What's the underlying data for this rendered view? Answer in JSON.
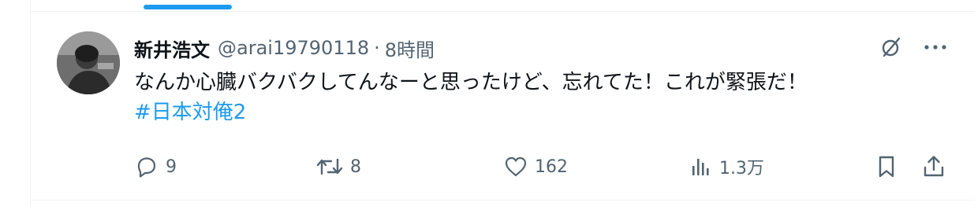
{
  "post": {
    "display_name": "新井浩文",
    "handle": "@arai19790118",
    "separator": "·",
    "time": "8時間",
    "text": "なんか心臓バクバクしてんなーと思ったけど、忘れてた！これが緊張だ！",
    "hashtag": "#日本対俺2"
  },
  "actions": {
    "reply_count": "9",
    "repost_count": "8",
    "like_count": "162",
    "views_count": "1.3万"
  },
  "icons": {
    "grok": "grok-icon",
    "more": "more-icon",
    "reply": "reply-icon",
    "repost": "repost-icon",
    "like": "heart-icon",
    "views": "analytics-icon",
    "bookmark": "bookmark-icon",
    "share": "share-icon"
  },
  "colors": {
    "accent": "#1d9bf0",
    "text": "#0f1419",
    "muted": "#536471",
    "border": "#eff3f4"
  }
}
